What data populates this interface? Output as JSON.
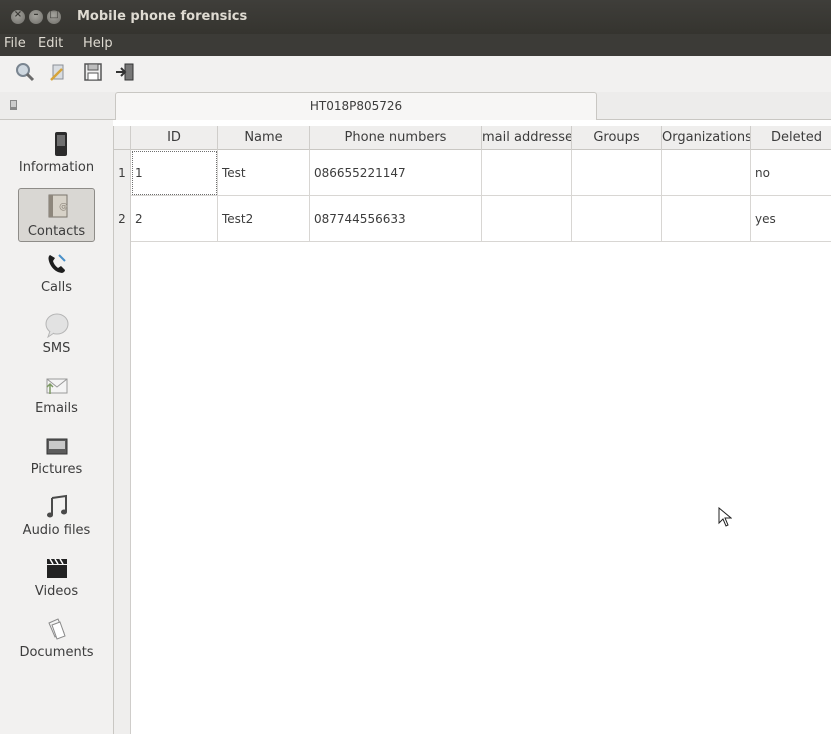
{
  "window": {
    "title": "Mobile phone forensics"
  },
  "menu": {
    "file": "File",
    "edit": "Edit",
    "help": "Help"
  },
  "toolbar": {
    "icons": [
      "search-icon",
      "magic-wand-icon",
      "save-icon",
      "exit-icon"
    ]
  },
  "tab": {
    "label": "HT018P805726"
  },
  "sidebar": {
    "items": [
      {
        "label": "Information",
        "icon": "phone-icon"
      },
      {
        "label": "Contacts",
        "icon": "contacts-icon",
        "selected": true
      },
      {
        "label": "Calls",
        "icon": "call-icon"
      },
      {
        "label": "SMS",
        "icon": "sms-bubble-icon"
      },
      {
        "label": "Emails",
        "icon": "email-icon"
      },
      {
        "label": "Pictures",
        "icon": "pictures-icon"
      },
      {
        "label": "Audio files",
        "icon": "audio-icon"
      },
      {
        "label": "Videos",
        "icon": "video-clapper-icon"
      },
      {
        "label": "Documents",
        "icon": "documents-icon"
      }
    ]
  },
  "table": {
    "columns": [
      "ID",
      "Name",
      "Phone numbers",
      "mail addresse",
      "Groups",
      "Organizations",
      "Deleted"
    ],
    "rows": [
      {
        "num": "1",
        "id": "1",
        "name": "Test",
        "phone": "086655221147",
        "mail": "",
        "groups": "",
        "orgs": "",
        "deleted": "no"
      },
      {
        "num": "2",
        "id": "2",
        "name": "Test2",
        "phone": "087744556633",
        "mail": "",
        "groups": "",
        "orgs": "",
        "deleted": "yes"
      }
    ]
  }
}
